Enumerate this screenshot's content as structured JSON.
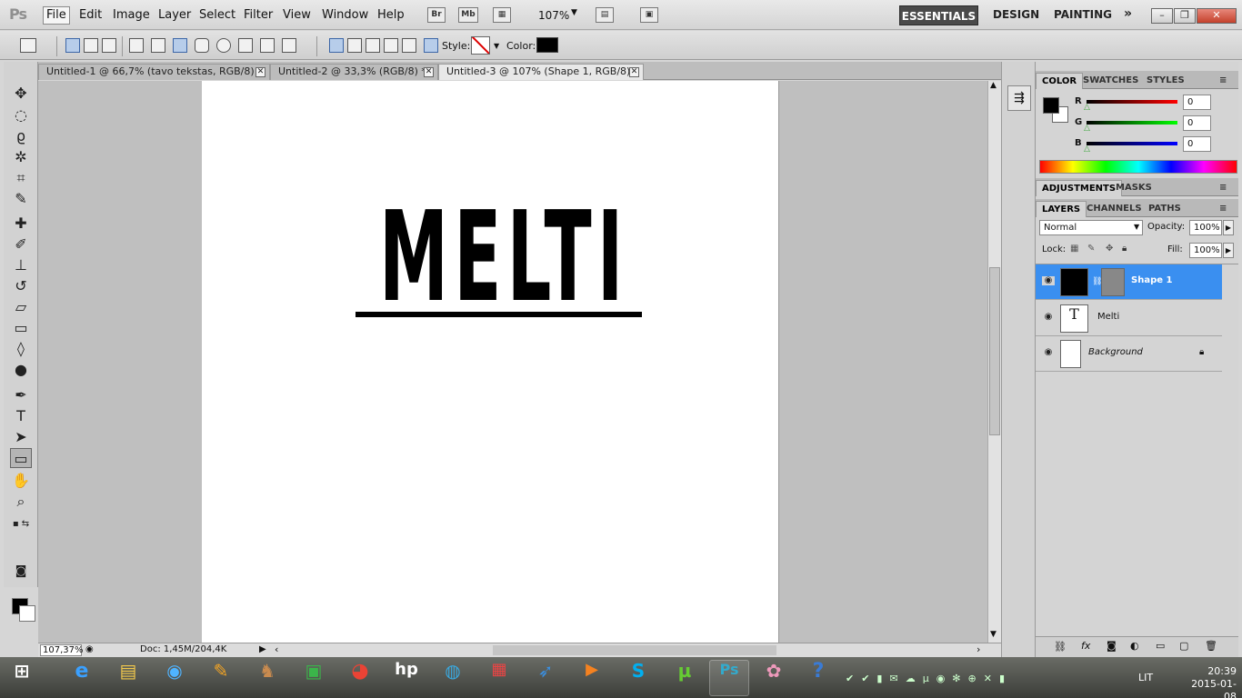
{
  "app": {
    "logo": "Ps"
  },
  "menu": [
    "File",
    "Edit",
    "Image",
    "Layer",
    "Select",
    "Filter",
    "View",
    "Window",
    "Help"
  ],
  "menubar": {
    "bridge": "Br",
    "mini_bridge": "Mb",
    "zoom": "107%"
  },
  "workspaces": [
    "ESSENTIALS",
    "DESIGN",
    "PAINTING"
  ],
  "options": {
    "style_label": "Style:",
    "color_label": "Color:",
    "color": "#000000"
  },
  "tabs": [
    {
      "label": "Untitled-1 @ 66,7% (tavo tekstas, RGB/8) *"
    },
    {
      "label": "Untitled-2 @ 33,3% (RGB/8) *"
    },
    {
      "label": "Untitled-3 @ 107% (Shape 1, RGB/8) *"
    }
  ],
  "canvas": {
    "text": "MELTI"
  },
  "status": {
    "zoom": "107,37%",
    "doc": "Doc: 1,45M/204,4K"
  },
  "color_panel": {
    "tabs": [
      "COLOR",
      "SWATCHES",
      "STYLES"
    ],
    "r_label": "R",
    "g_label": "G",
    "b_label": "B",
    "r": "0",
    "g": "0",
    "b": "0"
  },
  "adjust_tabs": [
    "ADJUSTMENTS",
    "MASKS"
  ],
  "layers_panel": {
    "tabs": [
      "LAYERS",
      "CHANNELS",
      "PATHS"
    ],
    "blend_mode": "Normal",
    "opacity_label": "Opacity:",
    "opacity": "100%",
    "lock_label": "Lock:",
    "fill_label": "Fill:",
    "fill": "100%",
    "layers": [
      {
        "name": "Shape 1",
        "selected": true
      },
      {
        "name": "Melti",
        "selected": false
      },
      {
        "name": "Background",
        "selected": false
      }
    ]
  },
  "taskbar": {
    "lang": "LIT",
    "time": "20:39",
    "date": "2015-01-08"
  }
}
